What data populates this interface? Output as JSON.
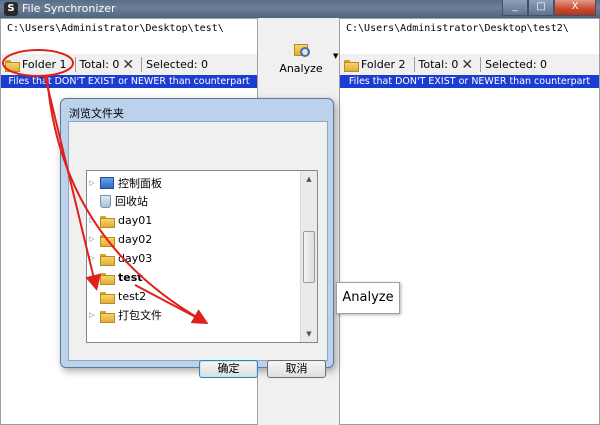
{
  "window": {
    "title": "File Synchronizer",
    "app_icon_glyph": "S",
    "buttons": {
      "minimize": "_",
      "maximize": "□",
      "close": "X"
    }
  },
  "left_panel": {
    "path": "C:\\Users\\Administrator\\Desktop\\test\\",
    "folder_label": "Folder 1",
    "total": "Total: 0",
    "selected": "Selected: 0",
    "filter_text": "Files that DON'T EXIST or NEWER than counterpart"
  },
  "right_panel": {
    "path": "C:\\Users\\Administrator\\Desktop\\test2\\",
    "folder_label": "Folder 2",
    "total": "Total: 0",
    "selected": "Selected: 0",
    "filter_text": "Files that DON'T EXIST or NEWER than counterpart"
  },
  "toolbar": {
    "analyze_label": "Analyze"
  },
  "tooltip": {
    "text": "Analyze"
  },
  "dialog": {
    "title": "浏览文件夹",
    "tree": [
      {
        "label": "控制面板",
        "icon": "control-panel-icon",
        "expandable": true
      },
      {
        "label": "回收站",
        "icon": "recycle-bin-icon",
        "expandable": false
      },
      {
        "label": "day01",
        "icon": "folder-icon",
        "expandable": true
      },
      {
        "label": "day02",
        "icon": "folder-icon",
        "expandable": true
      },
      {
        "label": "day03",
        "icon": "folder-icon",
        "expandable": true
      },
      {
        "label": "test",
        "icon": "folder-icon",
        "expandable": false,
        "selected": true
      },
      {
        "label": "test2",
        "icon": "folder-icon",
        "expandable": false
      },
      {
        "label": "打包文件",
        "icon": "folder-icon",
        "expandable": true
      }
    ],
    "ok_label": "确定",
    "cancel_label": "取消"
  },
  "colors": {
    "filter_bar": "#1c3dd1",
    "annotation": "#e0201c"
  }
}
